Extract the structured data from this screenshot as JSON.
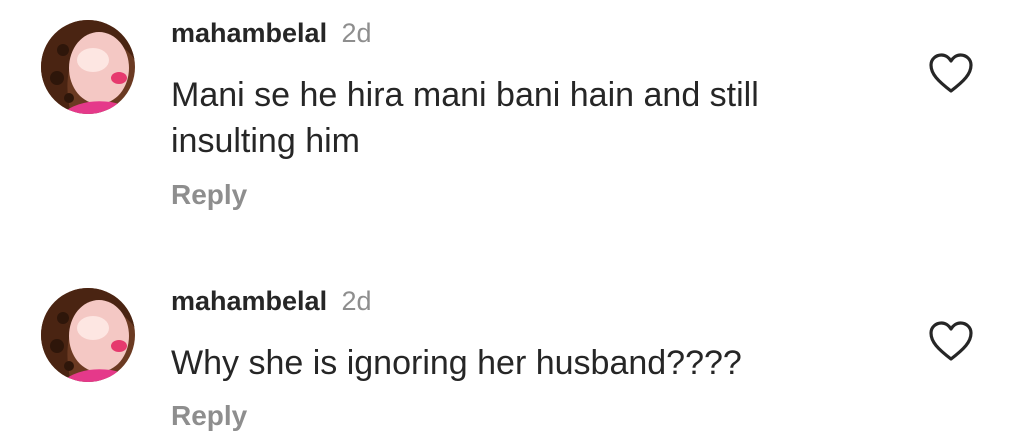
{
  "comments": [
    {
      "username": "mahambelal",
      "time": "2d",
      "text": "Mani se he hira mani bani hain and still insulting him",
      "reply_label": "Reply",
      "like_icon": "heart-outline-icon"
    },
    {
      "username": "mahambelal",
      "time": "2d",
      "text": "Why she is ignoring her husband????",
      "reply_label": "Reply",
      "like_icon": "heart-outline-icon"
    }
  ],
  "colors": {
    "text_primary": "#262626",
    "text_secondary": "#8e8e8e",
    "background": "#ffffff"
  }
}
